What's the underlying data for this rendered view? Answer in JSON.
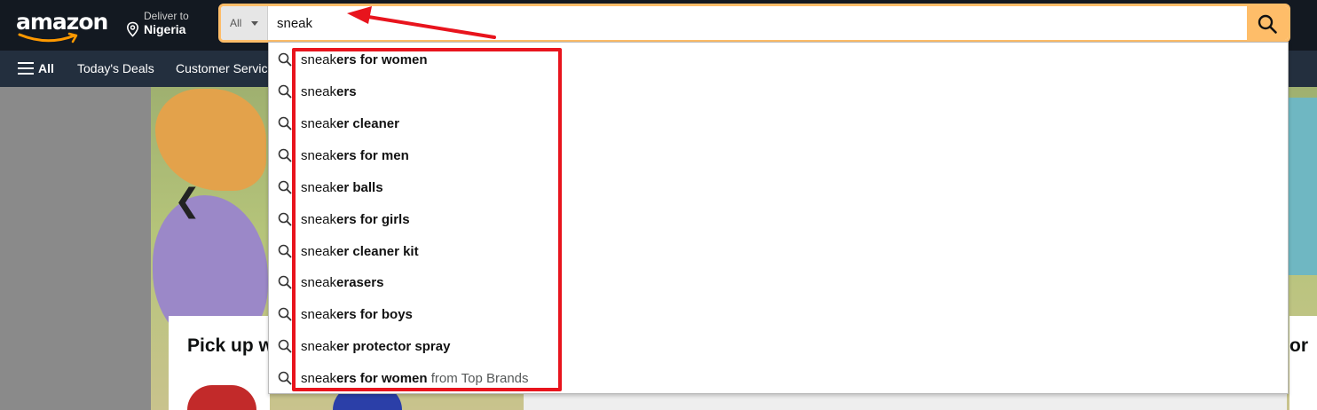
{
  "header": {
    "logo_text": "amazon",
    "deliver_label": "Deliver to",
    "deliver_location": "Nigeria"
  },
  "search": {
    "category": "All",
    "value": "sneak"
  },
  "nav": {
    "all_label": "All",
    "items": [
      "Today's Deals",
      "Customer Servic"
    ]
  },
  "suggestions": [
    {
      "typed": "sneak",
      "rest": "ers for women",
      "extra": ""
    },
    {
      "typed": "sneak",
      "rest": "ers",
      "extra": ""
    },
    {
      "typed": "sneak",
      "rest": "er cleaner",
      "extra": ""
    },
    {
      "typed": "sneak",
      "rest": "ers for men",
      "extra": ""
    },
    {
      "typed": "sneak",
      "rest": "er balls",
      "extra": ""
    },
    {
      "typed": "sneak",
      "rest": "ers for girls",
      "extra": ""
    },
    {
      "typed": "sneak",
      "rest": "er cleaner kit",
      "extra": ""
    },
    {
      "typed": "sneak",
      "rest": "erasers",
      "extra": ""
    },
    {
      "typed": "sneak",
      "rest": "ers for boys",
      "extra": ""
    },
    {
      "typed": "sneak",
      "rest": "er protector spray",
      "extra": ""
    },
    {
      "typed": "sneak",
      "rest": "ers for women",
      "extra": " from Top Brands"
    }
  ],
  "background": {
    "card_left_title": "Pick up w",
    "card_right_title": "or"
  },
  "colors": {
    "nav_dark": "#131921",
    "nav_sub": "#232f3e",
    "search_accent": "#febd69",
    "annotation_red": "#e8141d"
  }
}
